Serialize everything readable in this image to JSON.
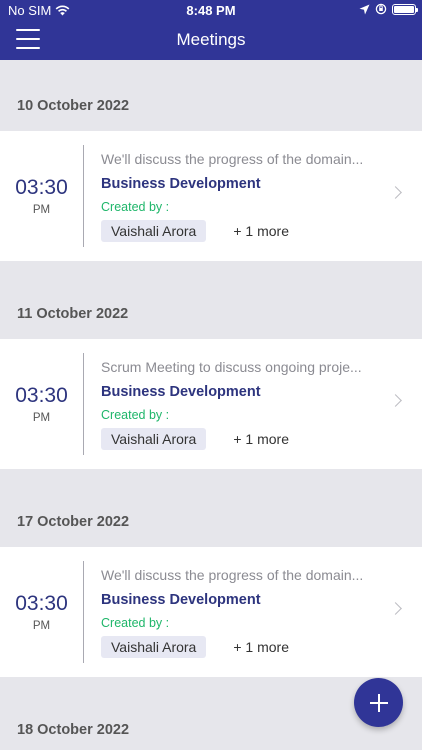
{
  "status_bar": {
    "carrier": "No SIM",
    "time": "8:48 PM"
  },
  "navbar": {
    "title": "Meetings"
  },
  "groups": [
    {
      "date": "10 October 2022",
      "meeting": {
        "time": "03:30",
        "ampm": "PM",
        "description": "We'll discuss the progress of the domain...",
        "team": "Business Development",
        "created_by_label": "Created by :",
        "creator": "Vaishali Arora",
        "more": "+ 1 more"
      }
    },
    {
      "date": "11 October 2022",
      "meeting": {
        "time": "03:30",
        "ampm": "PM",
        "description": "Scrum Meeting to discuss ongoing proje...",
        "team": "Business Development",
        "created_by_label": "Created by :",
        "creator": "Vaishali Arora",
        "more": "+ 1 more"
      }
    },
    {
      "date": "17 October 2022",
      "meeting": {
        "time": "03:30",
        "ampm": "PM",
        "description": "We'll discuss the progress of the domain...",
        "team": "Business Development",
        "created_by_label": "Created by :",
        "creator": "Vaishali Arora",
        "more": "+ 1 more"
      }
    },
    {
      "date": "18 October 2022"
    }
  ],
  "colors": {
    "primary": "#303597",
    "accent_green": "#1fb66a",
    "background": "#e6e6eb"
  }
}
